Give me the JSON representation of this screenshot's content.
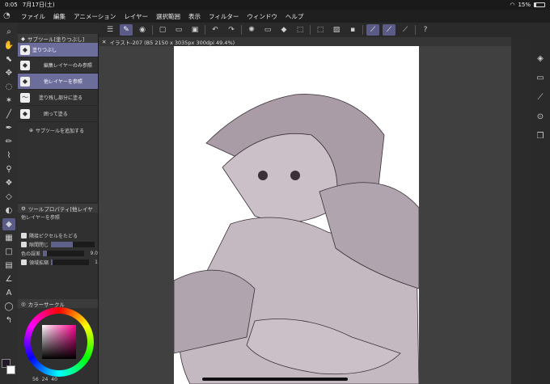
{
  "status": {
    "time": "0:05",
    "date": "7月17日(土)",
    "battery": "15%",
    "battery_level": 0.15
  },
  "menu": [
    "ファイル",
    "編集",
    "アニメーション",
    "レイヤー",
    "選択範囲",
    "表示",
    "フィルター",
    "ウィンドウ",
    "ヘルプ"
  ],
  "subtool_panel": {
    "title": "サブツール[塗りつぶし]",
    "items": [
      {
        "label": "塗りつぶし",
        "selected": true
      },
      {
        "label": "編集レイヤーのみ参照",
        "selected": false
      },
      {
        "label": "他レイヤーを参照",
        "selected": true
      },
      {
        "label": "塗り残し部分に塗る",
        "selected": false
      },
      {
        "label": "囲って塗る",
        "selected": false
      }
    ],
    "add_label": "サブツールを追加する"
  },
  "tool_property": {
    "title": "ツールプロパティ[他レイヤ",
    "subtitle": "他レイヤーを参照",
    "rows": [
      {
        "label": "隣接ピクセルをたどる",
        "value": "",
        "level": 0
      },
      {
        "label": "隙間閉じ",
        "value": "",
        "level": 0.5
      },
      {
        "label": "色の誤差",
        "value": "9.0",
        "level": 0.1
      },
      {
        "label": "領域拡縮",
        "value": "1",
        "level": 0.05
      }
    ]
  },
  "color_panel": {
    "title": "カラーサークル",
    "values": [
      "56",
      "24",
      "40"
    ]
  },
  "canvas_tab": {
    "title": "イラスト-207 (B5 2150 x 3035px 300dpi 49.4%)"
  }
}
